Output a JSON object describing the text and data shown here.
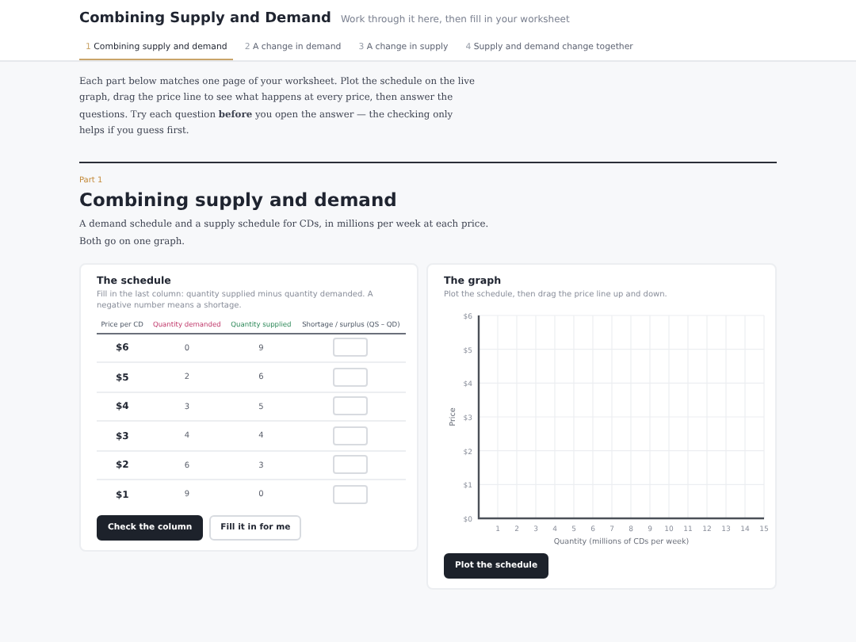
{
  "header": {
    "title": "Combining Supply and Demand",
    "subtitle": "Work through it here, then fill in your worksheet"
  },
  "tabs": [
    {
      "number": "1",
      "label": "Combining supply and demand",
      "selected": true
    },
    {
      "number": "2",
      "label": "A change in demand",
      "selected": false
    },
    {
      "number": "3",
      "label": "A change in supply",
      "selected": false
    },
    {
      "number": "4",
      "label": "Supply and demand change together",
      "selected": false
    }
  ],
  "intro": "Each part below matches one page of your worksheet. Plot the schedule on the live graph, drag the price line to see what happens at every price, then answer the questions. Try each question **before** you open the answer — the checking only helps if you guess first.",
  "part": {
    "eyebrow": "Part 1",
    "title": "Combining supply and demand",
    "description": "A demand schedule and a supply schedule for CDs, in millions per week at each price. Both go on one graph."
  },
  "schedule": {
    "title": "The schedule",
    "hint": "Fill in the last column: quantity supplied minus quantity demanded. A negative number means a shortage.",
    "columns": [
      {
        "label": "Price per CD",
        "kind": "plain"
      },
      {
        "label": "Quantity demanded",
        "kind": "demand"
      },
      {
        "label": "Quantity supplied",
        "kind": "supply"
      },
      {
        "label": "Shortage / surplus (QS – QD)",
        "kind": "plain"
      }
    ],
    "rows": [
      {
        "price": "$6",
        "demanded": "0",
        "supplied": "9"
      },
      {
        "price": "$5",
        "demanded": "2",
        "supplied": "6"
      },
      {
        "price": "$4",
        "demanded": "3",
        "supplied": "5"
      },
      {
        "price": "$3",
        "demanded": "4",
        "supplied": "4"
      },
      {
        "price": "$2",
        "demanded": "6",
        "supplied": "3"
      },
      {
        "price": "$1",
        "demanded": "9",
        "supplied": "0"
      }
    ],
    "buttons": [
      {
        "label": "Check the column",
        "kind": "primary"
      },
      {
        "label": "Fill it in for me",
        "kind": "secondary"
      }
    ]
  },
  "graph": {
    "title": "The graph",
    "hint": "Plot the schedule, then drag the price line up and down.",
    "chart_data": {
      "type": "line",
      "grid": true,
      "xlabel": "Quantity (millions of CDs per week)",
      "ylabel": "Price",
      "xlim": [
        0,
        15
      ],
      "ylim": [
        0,
        6
      ],
      "xticks": [
        1,
        2,
        3,
        4,
        5,
        6,
        7,
        8,
        9,
        10,
        11,
        12,
        13,
        14,
        15
      ],
      "yticks": [
        {
          "value": 0,
          "label": "$0"
        },
        {
          "value": 1,
          "label": "$1"
        },
        {
          "value": 2,
          "label": "$2"
        },
        {
          "value": 3,
          "label": "$3"
        },
        {
          "value": 4,
          "label": "$4"
        },
        {
          "value": 5,
          "label": "$5"
        },
        {
          "value": 6,
          "label": "$6"
        }
      ]
    },
    "button": "Plot the schedule"
  }
}
